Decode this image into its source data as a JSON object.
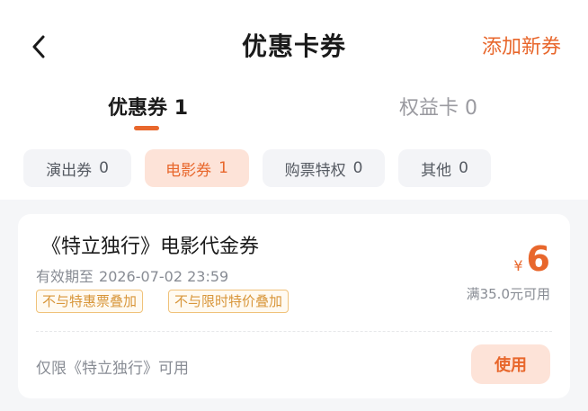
{
  "header": {
    "back_icon": "chevron-left-icon",
    "title": "优惠卡券",
    "add_label": "添加新券"
  },
  "main_tabs": [
    {
      "label": "优惠券",
      "count": "1",
      "active": true
    },
    {
      "label": "权益卡",
      "count": "0",
      "active": false
    }
  ],
  "filters": [
    {
      "label": "演出券",
      "count": "0",
      "active": false
    },
    {
      "label": "电影券",
      "count": "1",
      "active": true
    },
    {
      "label": "购票特权",
      "count": "0",
      "active": false
    },
    {
      "label": "其他",
      "count": "0",
      "active": false
    }
  ],
  "coupon": {
    "title": "《特立独行》电影代金券",
    "validity_label": "有效期至",
    "validity_date": "2026-07-02 23:59",
    "tags": [
      "不与特惠票叠加",
      "不与限时特价叠加"
    ],
    "currency": "¥",
    "amount": "6",
    "condition": "满35.0元可用",
    "usage_limit": "仅限《特立独行》可用",
    "use_label": "使用"
  },
  "colors": {
    "accent": "#e8672c",
    "accent_bg": "#fde3d8",
    "tag_border": "#f0c27a",
    "tag_text": "#d8963a"
  }
}
